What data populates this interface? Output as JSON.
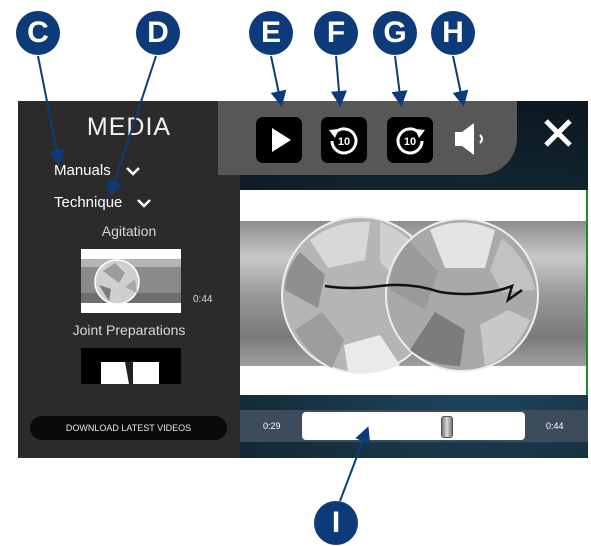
{
  "callouts": {
    "c": "C",
    "d": "D",
    "e": "E",
    "f": "F",
    "g": "G",
    "h": "H",
    "i": "I"
  },
  "sidebar": {
    "title": "MEDIA",
    "manuals_label": "Manuals",
    "technique_label": "Technique",
    "videos": [
      {
        "title": "Agitation",
        "duration": "0:44"
      },
      {
        "title": "Joint Preparations"
      }
    ],
    "download_label": "DOWNLOAD LATEST VIDEOS"
  },
  "controls": {
    "play": "play-icon",
    "rewind_10": "10",
    "forward_10": "10",
    "volume": "volume-icon",
    "close": "close-icon"
  },
  "player": {
    "current_time": "0:29",
    "total_time": "0:44",
    "progress_fraction": 0.66
  },
  "colors": {
    "callout": "#0d3b7a",
    "accent_edge": "#1a8a2a"
  }
}
